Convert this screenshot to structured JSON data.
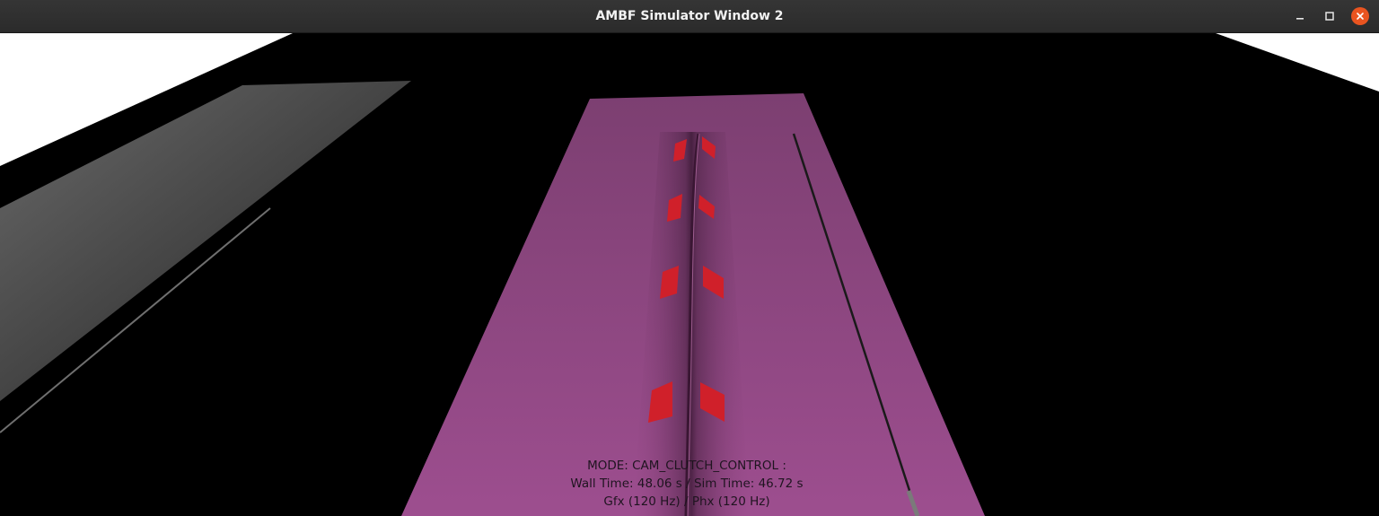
{
  "window": {
    "title": "AMBF Simulator Window 2"
  },
  "controls": {
    "minimize_icon": "minimize-icon",
    "maximize_icon": "maximize-icon",
    "close_icon": "close-icon"
  },
  "hud": {
    "mode": "MODE: CAM_CLUTCH_CONTROL :",
    "time": "Wall Time: 48.06 s / Sim Time: 46.72 s",
    "rate": "Gfx (120 Hz) / Phx (120 Hz)"
  },
  "colors": {
    "titlebar": "#2f2f2f",
    "close_button": "#e95420",
    "tissue": "#9a4d8b",
    "marker": "#d0202a",
    "background": "#000000"
  }
}
